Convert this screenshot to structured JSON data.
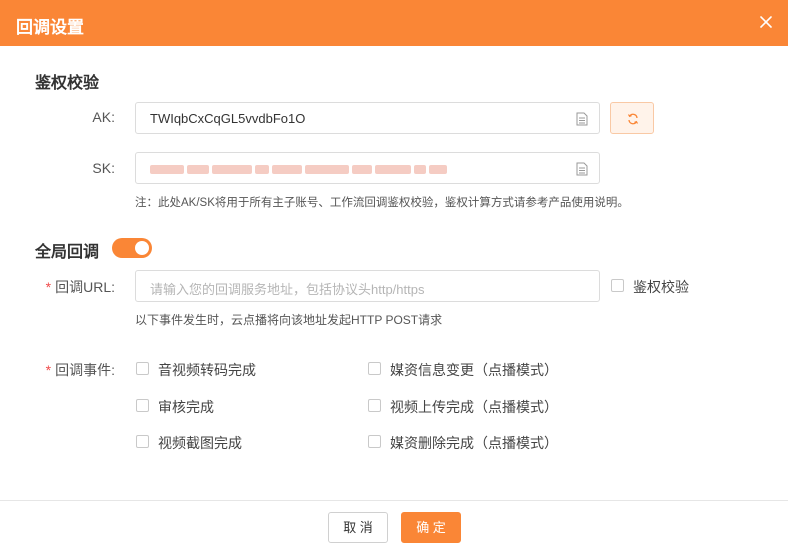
{
  "dialog": {
    "title": "回调设置",
    "close_icon": "close-icon"
  },
  "auth": {
    "section_title": "鉴权校验",
    "ak_label": "AK:",
    "ak_value": "TWIqbCxCqGL5vvdbFo1O",
    "sk_label": "SK:",
    "note": "注：此处AK/SK将用于所有主子账号、工作流回调鉴权校验，鉴权计算方式请参考产品使用说明。"
  },
  "global_callback": {
    "section_title": "全局回调",
    "enabled": true,
    "url_label": "回调URL:",
    "url_placeholder": "请输入您的回调服务地址，包括协议头http/https",
    "url_value": "",
    "auth_check_label": "鉴权校验",
    "auth_check_checked": false,
    "url_note": "以下事件发生时，云点播将向该地址发起HTTP POST请求",
    "events_label": "回调事件:",
    "events": [
      {
        "label": "音视频转码完成",
        "checked": false
      },
      {
        "label": "媒资信息变更（点播模式）",
        "checked": false
      },
      {
        "label": "审核完成",
        "checked": false
      },
      {
        "label": "视频上传完成（点播模式）",
        "checked": false
      },
      {
        "label": "视频截图完成",
        "checked": false
      },
      {
        "label": "媒资删除完成（点播模式）",
        "checked": false
      }
    ]
  },
  "footer": {
    "cancel_label": "取 消",
    "ok_label": "确 定"
  },
  "colors": {
    "accent": "#fa8636",
    "required": "#f04b4b"
  }
}
